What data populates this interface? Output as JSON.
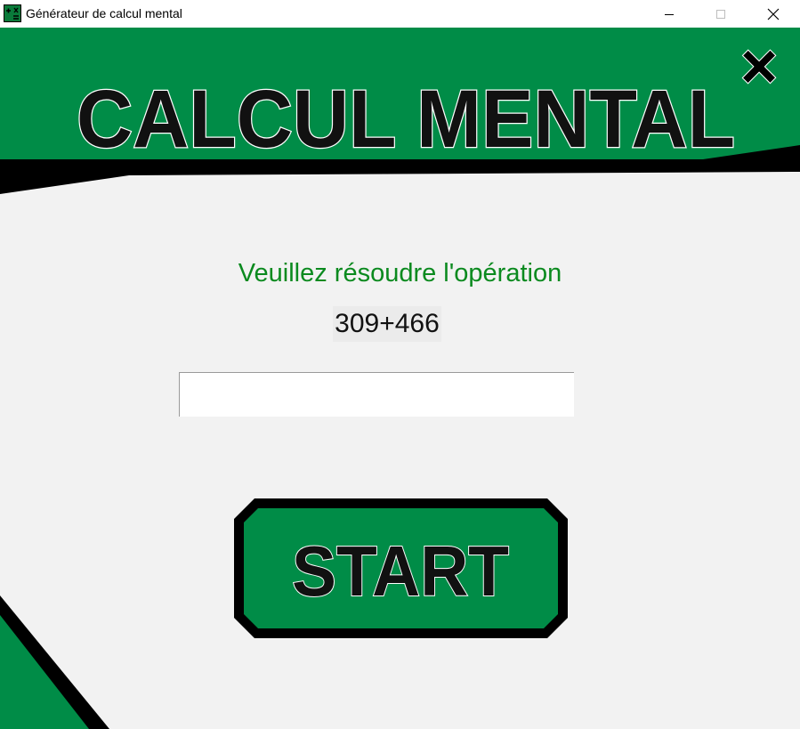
{
  "window": {
    "title": "Générateur de calcul mental",
    "icon": "calculator-app-icon",
    "controls": [
      "minimize-icon",
      "maximize-icon",
      "close-icon"
    ]
  },
  "banner": {
    "title": "CALCUL MENTAL",
    "badge": "×"
  },
  "main": {
    "prompt": "Veuillez résoudre l'opération",
    "operation": "309+466",
    "answer_value": "",
    "answer_placeholder": ""
  },
  "start_button": {
    "label": "START"
  },
  "colors": {
    "brand_green": "#008c47",
    "prompt_green": "#0b8a1f",
    "outline": "#000000",
    "background": "#f2f2f2"
  }
}
